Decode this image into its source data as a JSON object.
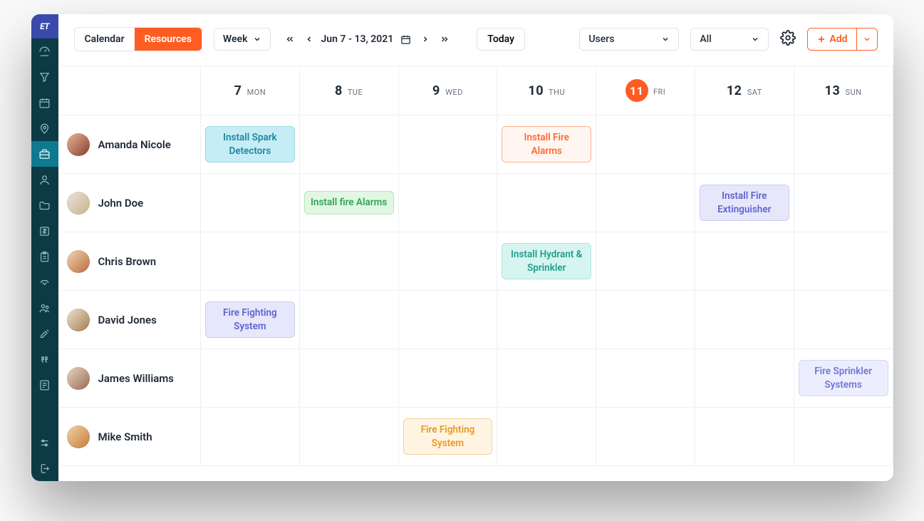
{
  "logo_text": "ET",
  "sidebar": {
    "items": [
      {
        "name": "dashboard-icon"
      },
      {
        "name": "funnel-icon"
      },
      {
        "name": "calendar-icon"
      },
      {
        "name": "map-pin-icon"
      },
      {
        "name": "briefcase-icon",
        "active": true
      },
      {
        "name": "user-icon"
      },
      {
        "name": "folder-icon"
      },
      {
        "name": "dollar-icon"
      },
      {
        "name": "clipboard-icon"
      },
      {
        "name": "handshake-icon"
      },
      {
        "name": "team-icon"
      },
      {
        "name": "tools-icon"
      },
      {
        "name": "quote-icon"
      },
      {
        "name": "report-icon"
      }
    ],
    "bottom": [
      {
        "name": "settings-sliders-icon"
      },
      {
        "name": "logout-icon"
      }
    ]
  },
  "toolbar": {
    "tabs": {
      "calendar": "Calendar",
      "resources": "Resources"
    },
    "view_label": "Week",
    "date_range": "Jun 7 - 13, 2021",
    "today_label": "Today",
    "filter_users": "Users",
    "filter_all": "All",
    "add_label": "Add"
  },
  "days": [
    {
      "num": "7",
      "dow": "MON"
    },
    {
      "num": "8",
      "dow": "TUE"
    },
    {
      "num": "9",
      "dow": "WED"
    },
    {
      "num": "10",
      "dow": "THU"
    },
    {
      "num": "11",
      "dow": "FRI",
      "today": true
    },
    {
      "num": "12",
      "dow": "SAT"
    },
    {
      "num": "13",
      "dow": "SUN"
    }
  ],
  "resources": [
    {
      "name": "Amanda Nicole",
      "avatar_hue": "linear-gradient(135deg,#e7b89a,#8a3b2f)",
      "events": {
        "0": {
          "title": "Install Spark Detectors",
          "color": "c-cyan"
        },
        "3": {
          "title": "Install Fire Alarms",
          "color": "c-orange"
        }
      }
    },
    {
      "name": "John Doe",
      "avatar_hue": "linear-gradient(135deg,#e9e4da,#c9b28c)",
      "events": {
        "1": {
          "title": "Install fire Alarms",
          "color": "c-green"
        },
        "5": {
          "title": "Install Fire Extinguisher",
          "color": "c-violet"
        }
      }
    },
    {
      "name": "Chris Brown",
      "avatar_hue": "linear-gradient(135deg,#f1d8b6,#b96a3d)",
      "events": {
        "3": {
          "title": "Install Hydrant & Sprinkler",
          "color": "c-teal"
        }
      }
    },
    {
      "name": "David Jones",
      "avatar_hue": "linear-gradient(135deg,#eae3d0,#a67c52)",
      "events": {
        "0": {
          "title": "Fire Fighting System",
          "color": "c-violet"
        }
      }
    },
    {
      "name": "James Williams",
      "avatar_hue": "linear-gradient(135deg,#e8d6c4,#9a6a52)",
      "events": {
        "6": {
          "title": "Fire Sprinkler Systems",
          "color": "c-vlight"
        }
      }
    },
    {
      "name": "Mike Smith",
      "avatar_hue": "linear-gradient(135deg,#efd3a7,#c77a3a)",
      "events": {
        "2": {
          "title": "Fire Fighting System",
          "color": "c-amber"
        }
      }
    }
  ]
}
